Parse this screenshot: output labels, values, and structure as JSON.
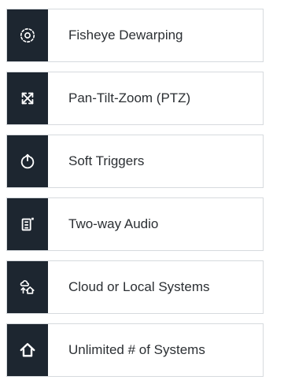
{
  "features": [
    {
      "label": "Fisheye Dewarping",
      "icon": "fisheye-icon"
    },
    {
      "label": "Pan-Tilt-Zoom (PTZ)",
      "icon": "ptz-arrows-icon"
    },
    {
      "label": "Soft Triggers",
      "icon": "power-trigger-icon"
    },
    {
      "label": "Two-way Audio",
      "icon": "intercom-icon"
    },
    {
      "label": "Cloud or Local Systems",
      "icon": "cloud-home-icon"
    },
    {
      "label": "Unlimited # of Systems",
      "icon": "home-icon"
    }
  ],
  "colors": {
    "icon_tile_bg": "#1d2630",
    "icon_fg": "#ffffff",
    "label_text": "#2b2f33",
    "row_border": "#d6dade"
  }
}
